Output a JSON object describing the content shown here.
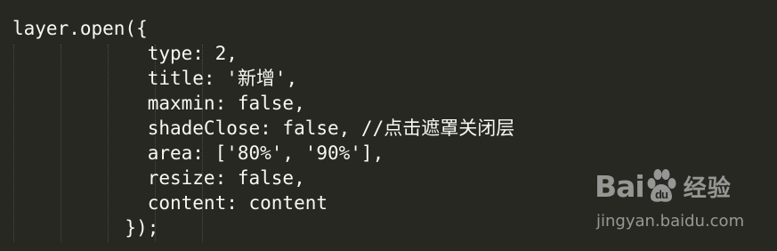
{
  "code": {
    "lines": [
      "layer.open({",
      "            type: 2,",
      "            title: '新增',",
      "            maxmin: false,",
      "            shadeClose: false, //点击遮罩关闭层",
      "            area: ['80%', '90%'],",
      "            resize: false,",
      "            content: content",
      "          });"
    ]
  },
  "watermark": {
    "brand_left": "Bai",
    "brand_right": "经验",
    "url": "jingyan.baidu.com",
    "paw_icon": "baidu-paw-icon"
  },
  "colors": {
    "background": "#272822",
    "text": "#f8f8f2",
    "indent_guide": "#4a4b44",
    "watermark": "#f2f2f2"
  }
}
